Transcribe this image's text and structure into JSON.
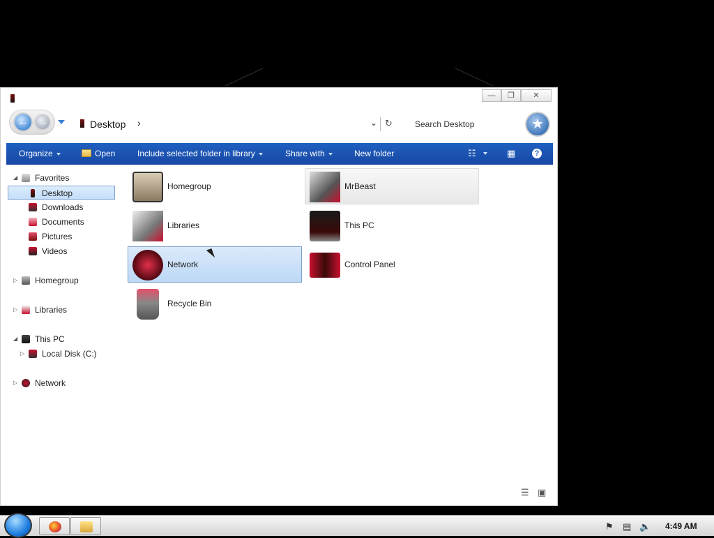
{
  "window": {
    "address": "Desktop",
    "search_placeholder": "Search Desktop",
    "minimize_glyph": "—",
    "maximize_glyph": "❐",
    "close_glyph": "✕"
  },
  "toolbar": {
    "organize": "Organize",
    "open": "Open",
    "include": "Include selected folder in library",
    "share": "Share with",
    "new_folder": "New folder"
  },
  "nav": {
    "favorites": "Favorites",
    "desktop": "Desktop",
    "downloads": "Downloads",
    "documents": "Documents",
    "pictures": "Pictures",
    "videos": "Videos",
    "homegroup": "Homegroup",
    "libraries": "Libraries",
    "this_pc": "This PC",
    "local_disk": "Local Disk (C:)",
    "network": "Network"
  },
  "items": {
    "homegroup": "Homegroup",
    "mrbeast": "MrBeast",
    "libraries": "Libraries",
    "this_pc": "This PC",
    "network": "Network",
    "control_panel": "Control Panel",
    "recycle_bin": "Recycle Bin"
  },
  "taskbar": {
    "clock": "4:49 AM"
  },
  "colors": {
    "toolbar": "#1f5fc0",
    "selection": "#c4defa",
    "accent_red": "#c8102e"
  }
}
